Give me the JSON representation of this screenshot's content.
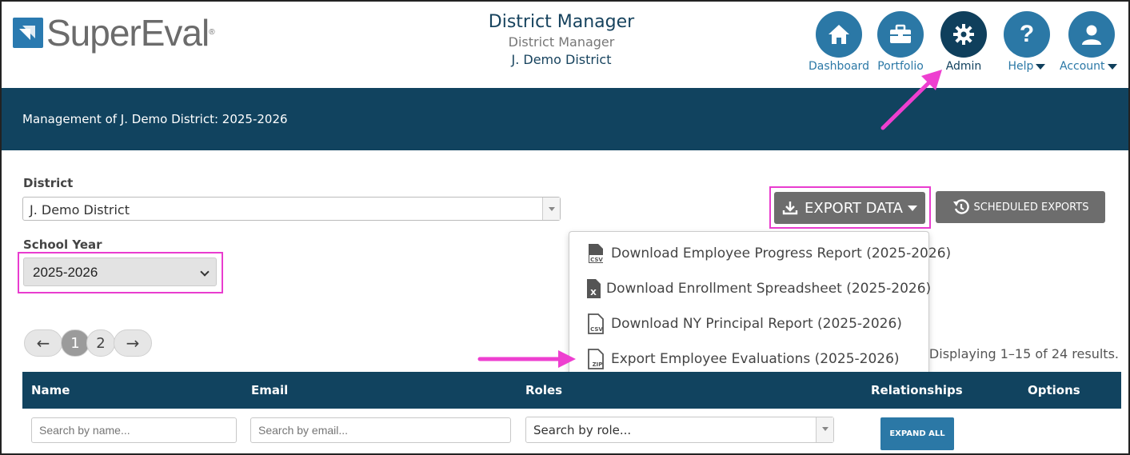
{
  "app": {
    "logo_text": "SuperEval",
    "logo_mark": "®"
  },
  "header": {
    "title": "District Manager",
    "role": "District Manager",
    "district": "J. Demo District"
  },
  "nav": [
    {
      "label": "Dashboard",
      "icon": "home-icon"
    },
    {
      "label": "Portfolio",
      "icon": "briefcase-icon"
    },
    {
      "label": "Admin",
      "icon": "gear-icon"
    },
    {
      "label": "Help",
      "icon": "question-icon"
    },
    {
      "label": "Account",
      "icon": "user-icon"
    }
  ],
  "banner": {
    "text": "Management of J. Demo District: 2025-2026"
  },
  "form": {
    "district_label": "District",
    "district_value": "J. Demo District",
    "year_label": "School Year",
    "year_value": "2025-2026"
  },
  "toolbar": {
    "export_label": "EXPORT DATA",
    "scheduled_label": "SCHEDULED EXPORTS"
  },
  "export_menu": [
    {
      "label": "Download Employee Progress Report (2025-2026)",
      "icon": "csv-file-icon",
      "tag": "CSV"
    },
    {
      "label": "Download Enrollment Spreadsheet (2025-2026)",
      "icon": "excel-file-icon",
      "tag": "X"
    },
    {
      "label": "Download NY Principal Report (2025-2026)",
      "icon": "csv-file-icon",
      "tag": "CSV"
    },
    {
      "label": "Export Employee Evaluations (2025-2026)",
      "icon": "zip-file-icon",
      "tag": "ZIP"
    }
  ],
  "pager": {
    "prev": "←",
    "pages": [
      "1",
      "2"
    ],
    "next": "→",
    "results": "Displaying 1–15 of 24 results."
  },
  "table": {
    "columns": [
      "Name",
      "Email",
      "Roles",
      "Relationships",
      "Options"
    ],
    "filters": {
      "name_placeholder": "Search by name...",
      "email_placeholder": "Search by email...",
      "role_placeholder": "Search by role...",
      "expand_label": "EXPAND ALL"
    }
  },
  "colors": {
    "primary": "#2b78a6",
    "dark": "#11435f",
    "highlight": "#e93ccf",
    "button_gray": "#6d6d6d"
  }
}
